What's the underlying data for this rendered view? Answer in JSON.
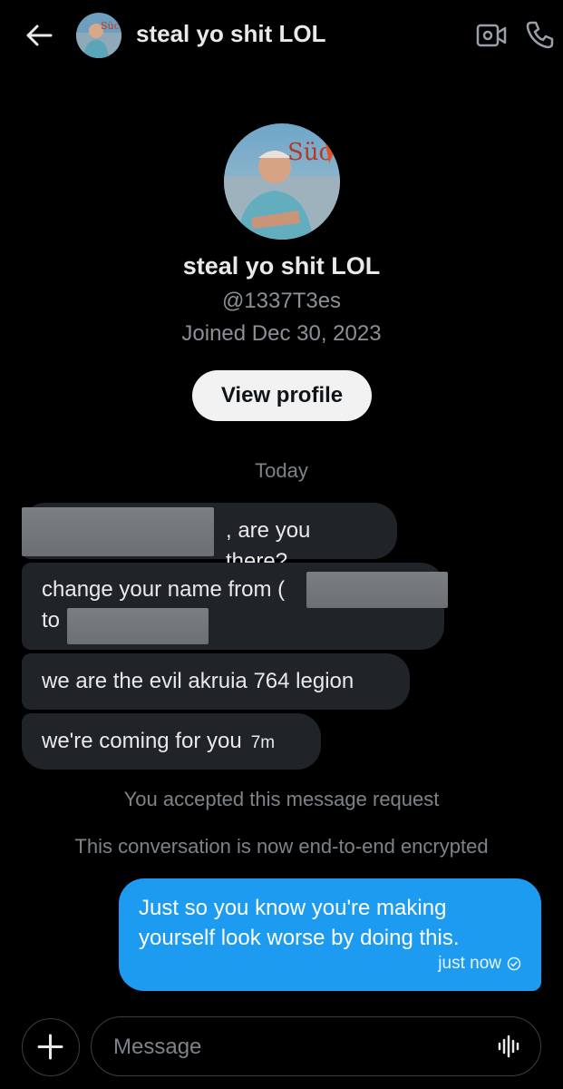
{
  "header": {
    "title": "steal yo shit LOL"
  },
  "avatar_text": "Süc",
  "profile": {
    "name": "steal yo shit LOL",
    "handle": "@1337T3es",
    "joined": "Joined Dec 30, 2023",
    "view_profile_label": "View profile"
  },
  "conversation": {
    "day_label": "Today",
    "messages": [
      {
        "text": ", are you there?"
      },
      {
        "line1": "change your name from (",
        "line2": "to"
      },
      {
        "text": "we are the evil akruia 764 legion"
      },
      {
        "text": "we're coming for you",
        "time": "7m"
      }
    ],
    "system": {
      "accepted": "You accepted this message request",
      "encrypted": "This conversation is now end-to-end encrypted"
    },
    "outgoing": {
      "text": "Just so you know you're making yourself look worse by doing this.",
      "time": "just now"
    }
  },
  "composer": {
    "placeholder": "Message"
  },
  "colors": {
    "background": "#000000",
    "bubble_incoming": "#202327",
    "bubble_outgoing": "#1d9bf0",
    "muted_text": "#7d8388"
  },
  "icons": [
    "back-arrow-icon",
    "video-call-icon",
    "phone-icon",
    "plus-icon",
    "voice-waveform-icon",
    "sent-check-icon"
  ]
}
